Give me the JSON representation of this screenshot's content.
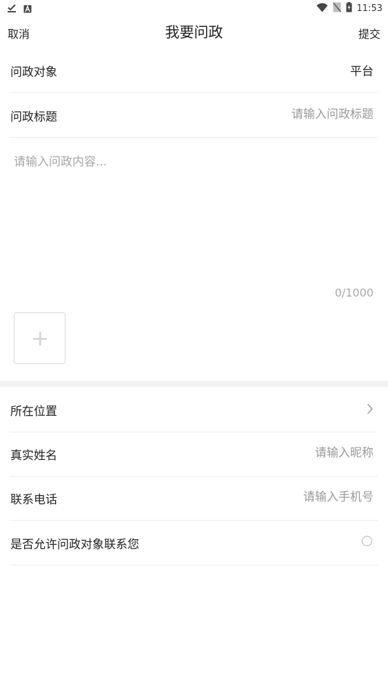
{
  "status_bar": {
    "time": "11:53",
    "icons": [
      "download-done-icon",
      "a-app-icon",
      "wifi-icon",
      "no-sim-icon",
      "battery-charging-icon"
    ]
  },
  "nav": {
    "cancel_label": "取消",
    "title": "我要问政",
    "submit_label": "提交"
  },
  "form": {
    "target": {
      "label": "问政对象",
      "value": "平台"
    },
    "title_field": {
      "label": "问政标题",
      "placeholder": "请输入问政标题"
    },
    "content": {
      "placeholder": "请输入问政内容...",
      "counter": "0/1000"
    },
    "upload": {
      "icon": "plus-icon"
    },
    "location": {
      "label": "所在位置",
      "icon": "chevron-right-icon"
    },
    "real_name": {
      "label": "真实姓名",
      "placeholder": "请输入昵称"
    },
    "phone": {
      "label": "联系电话",
      "placeholder": "请输入手机号"
    },
    "allow_contact": {
      "label": "是否允许问政对象联系您",
      "checked": false
    }
  },
  "colors": {
    "text": "#222222",
    "placeholder": "#9a9a9a",
    "divider": "#ececec",
    "section_gap": "#f3f3f3"
  }
}
